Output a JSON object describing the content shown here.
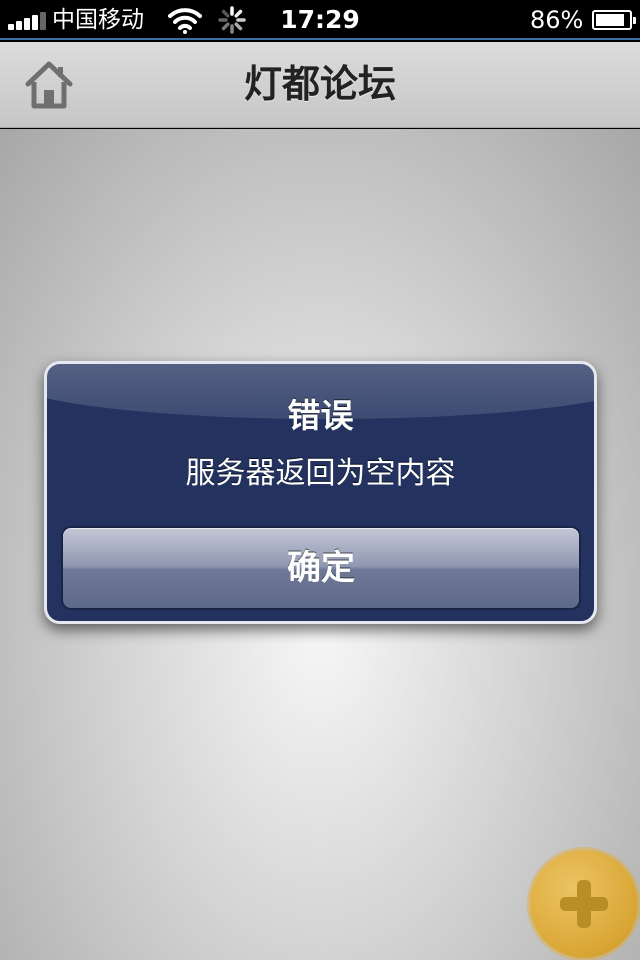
{
  "status_bar": {
    "signal_icon": "signal-bars",
    "carrier": "中国移动",
    "wifi_icon": "wifi",
    "activity_icon": "activity-spinner",
    "time": "17:29",
    "battery_percent": "86%",
    "battery_level": 0.86,
    "battery_icon": "battery"
  },
  "nav_bar": {
    "home_icon": "home",
    "title": "灯都论坛"
  },
  "alert": {
    "title": "错误",
    "message": "服务器返回为空内容",
    "confirm_label": "确定"
  },
  "fab": {
    "icon": "plus",
    "color": "#dfa31d"
  },
  "colors": {
    "alert_background": "#23325f",
    "nav_background": "#d2d2d2",
    "status_accent": "#3d6fa0"
  }
}
